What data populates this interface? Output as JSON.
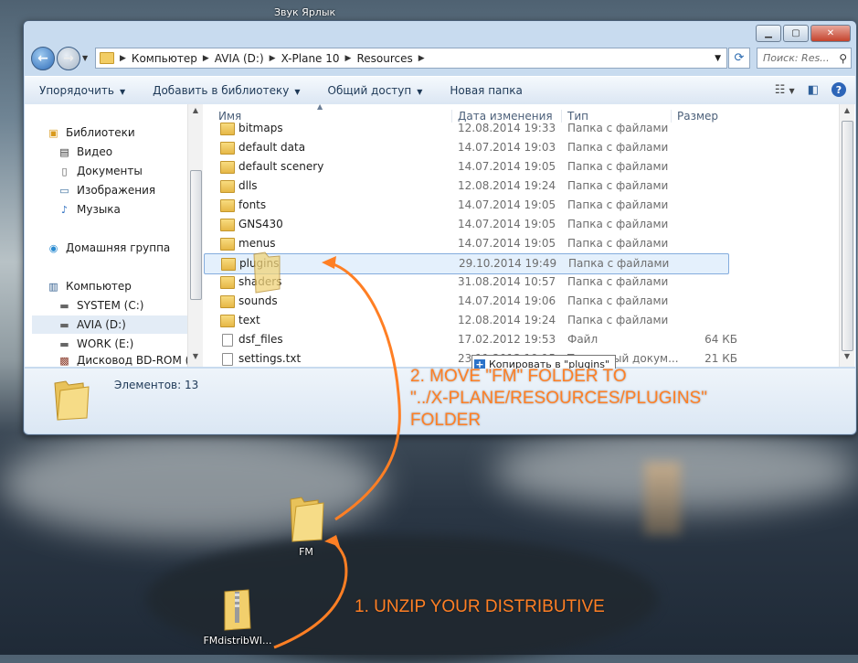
{
  "desktop": {
    "top_label": "Звук Ярлык",
    "icons": [
      {
        "label": "FM"
      },
      {
        "label": "FMdistribWI..."
      }
    ],
    "annotations": {
      "step1": "1. UNZIP YOUR DISTRIBUTIVE",
      "step2_line1": "2. MOVE \"FM\" FOLDER TO",
      "step2_line2": "\"../X-PLANE/RESOURCES/PLUGINS\"",
      "step2_line3": "FOLDER"
    },
    "accent_color": "#ff7f24"
  },
  "window": {
    "address": [
      "Компьютер",
      "AVIA (D:)",
      "X-Plane 10",
      "Resources"
    ],
    "search_placeholder": "Поиск: Res...",
    "toolbar": {
      "organize": "Упорядочить",
      "add_library": "Добавить в библиотеку",
      "share": "Общий доступ",
      "new_folder": "Новая папка"
    },
    "nav": [
      {
        "label": "Библиотеки",
        "icon": "libraries-icon"
      },
      {
        "label": "Видео",
        "icon": "video-icon"
      },
      {
        "label": "Документы",
        "icon": "documents-icon"
      },
      {
        "label": "Изображения",
        "icon": "pictures-icon"
      },
      {
        "label": "Музыка",
        "icon": "music-icon"
      },
      {
        "label": "Домашняя группа",
        "icon": "homegroup-icon"
      },
      {
        "label": "Компьютер",
        "icon": "computer-icon"
      },
      {
        "label": "SYSTEM (C:)",
        "icon": "drive-icon"
      },
      {
        "label": "AVIA (D:)",
        "icon": "drive-icon"
      },
      {
        "label": "WORK (E:)",
        "icon": "drive-icon"
      },
      {
        "label": "Дисковод BD-ROM (F:",
        "icon": "dvd-drive-icon"
      }
    ],
    "columns": {
      "name": "Имя",
      "date": "Дата изменения",
      "type": "Тип",
      "size": "Размер"
    },
    "files": [
      {
        "name": "bitmaps",
        "date": "12.08.2014 19:33",
        "type": "Папка с файлами",
        "size": "",
        "kind": "folder"
      },
      {
        "name": "default data",
        "date": "14.07.2014 19:03",
        "type": "Папка с файлами",
        "size": "",
        "kind": "folder"
      },
      {
        "name": "default scenery",
        "date": "14.07.2014 19:05",
        "type": "Папка с файлами",
        "size": "",
        "kind": "folder"
      },
      {
        "name": "dlls",
        "date": "12.08.2014 19:24",
        "type": "Папка с файлами",
        "size": "",
        "kind": "folder"
      },
      {
        "name": "fonts",
        "date": "14.07.2014 19:05",
        "type": "Папка с файлами",
        "size": "",
        "kind": "folder"
      },
      {
        "name": "GNS430",
        "date": "14.07.2014 19:05",
        "type": "Папка с файлами",
        "size": "",
        "kind": "folder"
      },
      {
        "name": "menus",
        "date": "14.07.2014 19:05",
        "type": "Папка с файлами",
        "size": "",
        "kind": "folder"
      },
      {
        "name": "plugins",
        "date": "29.10.2014 19:49",
        "type": "Папка с файлами",
        "size": "",
        "kind": "folder"
      },
      {
        "name": "shaders",
        "date": "31.08.2014 10:57",
        "type": "Папка с файлами",
        "size": "",
        "kind": "folder"
      },
      {
        "name": "sounds",
        "date": "14.07.2014 19:06",
        "type": "Папка с файлами",
        "size": "",
        "kind": "folder"
      },
      {
        "name": "text",
        "date": "12.08.2014 19:24",
        "type": "Папка с файлами",
        "size": "",
        "kind": "folder"
      },
      {
        "name": "dsf_files",
        "date": "17.02.2012 19:53",
        "type": "Файл",
        "size": "64 КБ",
        "kind": "file"
      },
      {
        "name": "settings.txt",
        "date": "23.11.2013 19:15",
        "type": "Текстовый докум...",
        "size": "21 КБ",
        "kind": "file"
      }
    ],
    "drag_tooltip": "Копировать в \"plugins\"",
    "status": "Элементов: 13"
  }
}
